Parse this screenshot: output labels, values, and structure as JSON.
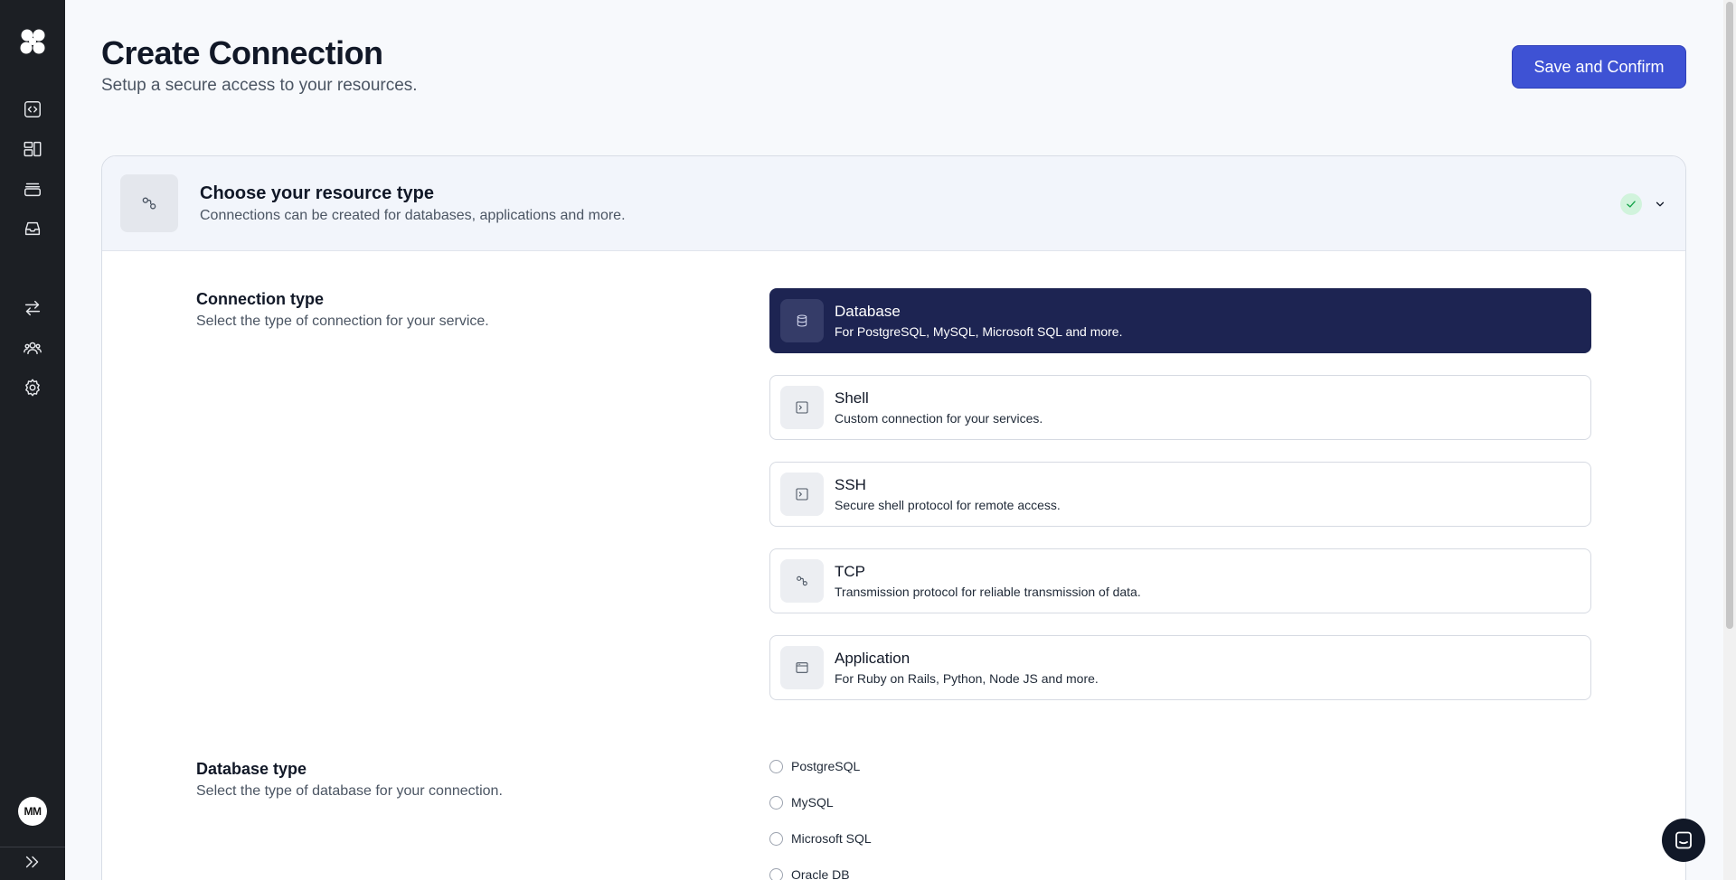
{
  "sidebar": {
    "logo_icon": "logo-icon",
    "items": [
      {
        "icon": "code-icon"
      },
      {
        "icon": "layout-icon"
      },
      {
        "icon": "layers-icon"
      },
      {
        "icon": "inbox-icon"
      },
      {
        "icon": "transfer-icon"
      },
      {
        "icon": "users-icon"
      },
      {
        "icon": "gear-icon"
      }
    ],
    "avatar_initials": "MM",
    "expand_icon": "chevrons-right-icon"
  },
  "header": {
    "title": "Create Connection",
    "subtitle": "Setup a secure access to your resources.",
    "save_label": "Save and Confirm"
  },
  "section": {
    "title": "Choose your resource type",
    "subtitle": "Connections can be created for databases, applications and more.",
    "completed": true
  },
  "connection_type": {
    "title": "Connection type",
    "subtitle": "Select the type of connection for your service.",
    "selected": "Database",
    "options": [
      {
        "title": "Database",
        "subtitle": "For PostgreSQL, MySQL, Microsoft SQL and more.",
        "icon": "database-icon"
      },
      {
        "title": "Shell",
        "subtitle": "Custom connection for your services.",
        "icon": "terminal-icon"
      },
      {
        "title": "SSH",
        "subtitle": "Secure shell protocol for remote access.",
        "icon": "terminal-icon"
      },
      {
        "title": "TCP",
        "subtitle": "Transmission protocol for reliable transmission of data.",
        "icon": "link-icon"
      },
      {
        "title": "Application",
        "subtitle": "For Ruby on Rails, Python, Node JS and more.",
        "icon": "browser-icon"
      }
    ]
  },
  "database_type": {
    "title": "Database type",
    "subtitle": "Select the type of database for your connection.",
    "options": [
      "PostgreSQL",
      "MySQL",
      "Microsoft SQL",
      "Oracle DB"
    ]
  },
  "colors": {
    "primary": "#3e52d4",
    "selected_option": "#1d2452",
    "sidebar": "#1c1f24",
    "success": "#16a34a"
  }
}
